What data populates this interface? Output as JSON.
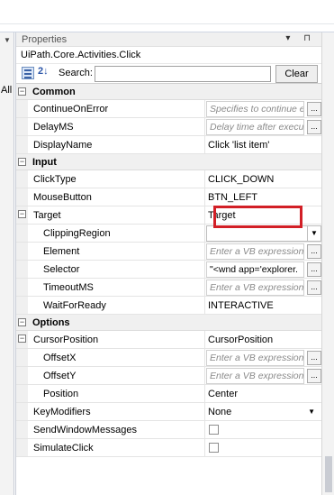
{
  "panel": {
    "title": "Properties",
    "header_buttons": "▾ ⊓",
    "object_type": "UiPath.Core.Activities.Click"
  },
  "toolbar": {
    "search_label": "Search:",
    "search_value": "",
    "clear_label": "Clear",
    "sort_icon_text": "2↓"
  },
  "left_sliver": {
    "text": "All"
  },
  "categories": {
    "common": "Common",
    "input": "Input",
    "options": "Options"
  },
  "rows": {
    "continue_on_error": {
      "name": "ContinueOnError",
      "placeholder": "Specifies to continue e"
    },
    "delay_ms": {
      "name": "DelayMS",
      "placeholder": "Delay time after execu"
    },
    "display_name": {
      "name": "DisplayName",
      "value": "Click 'list item'"
    },
    "click_type": {
      "name": "ClickType",
      "value": "CLICK_DOWN"
    },
    "mouse_button": {
      "name": "MouseButton",
      "value": "BTN_LEFT"
    },
    "target": {
      "name": "Target",
      "value": "Target"
    },
    "clipping_region": {
      "name": "ClippingRegion",
      "value": ""
    },
    "element": {
      "name": "Element",
      "placeholder": "Enter a VB expression"
    },
    "selector": {
      "name": "Selector",
      "value": "\"<wnd app='explorer."
    },
    "timeout_ms": {
      "name": "TimeoutMS",
      "placeholder": "Enter a VB expression"
    },
    "wait_for_ready": {
      "name": "WaitForReady",
      "value": "INTERACTIVE"
    },
    "cursor_position": {
      "name": "CursorPosition",
      "value": "CursorPosition"
    },
    "offset_x": {
      "name": "OffsetX",
      "placeholder": "Enter a VB expression"
    },
    "offset_y": {
      "name": "OffsetY",
      "placeholder": "Enter a VB expression"
    },
    "position": {
      "name": "Position",
      "value": "Center"
    },
    "key_modifiers": {
      "name": "KeyModifiers",
      "value": "None"
    },
    "send_window_messages": {
      "name": "SendWindowMessages",
      "checked": false
    },
    "simulate_click": {
      "name": "SimulateClick",
      "checked": false
    }
  },
  "icons": {
    "expander": "⊟",
    "ellipsis": "...",
    "dropdown_arrow": "▼"
  },
  "colors": {
    "highlight": "#d21f26",
    "category_bg": "#f0f0f0"
  }
}
